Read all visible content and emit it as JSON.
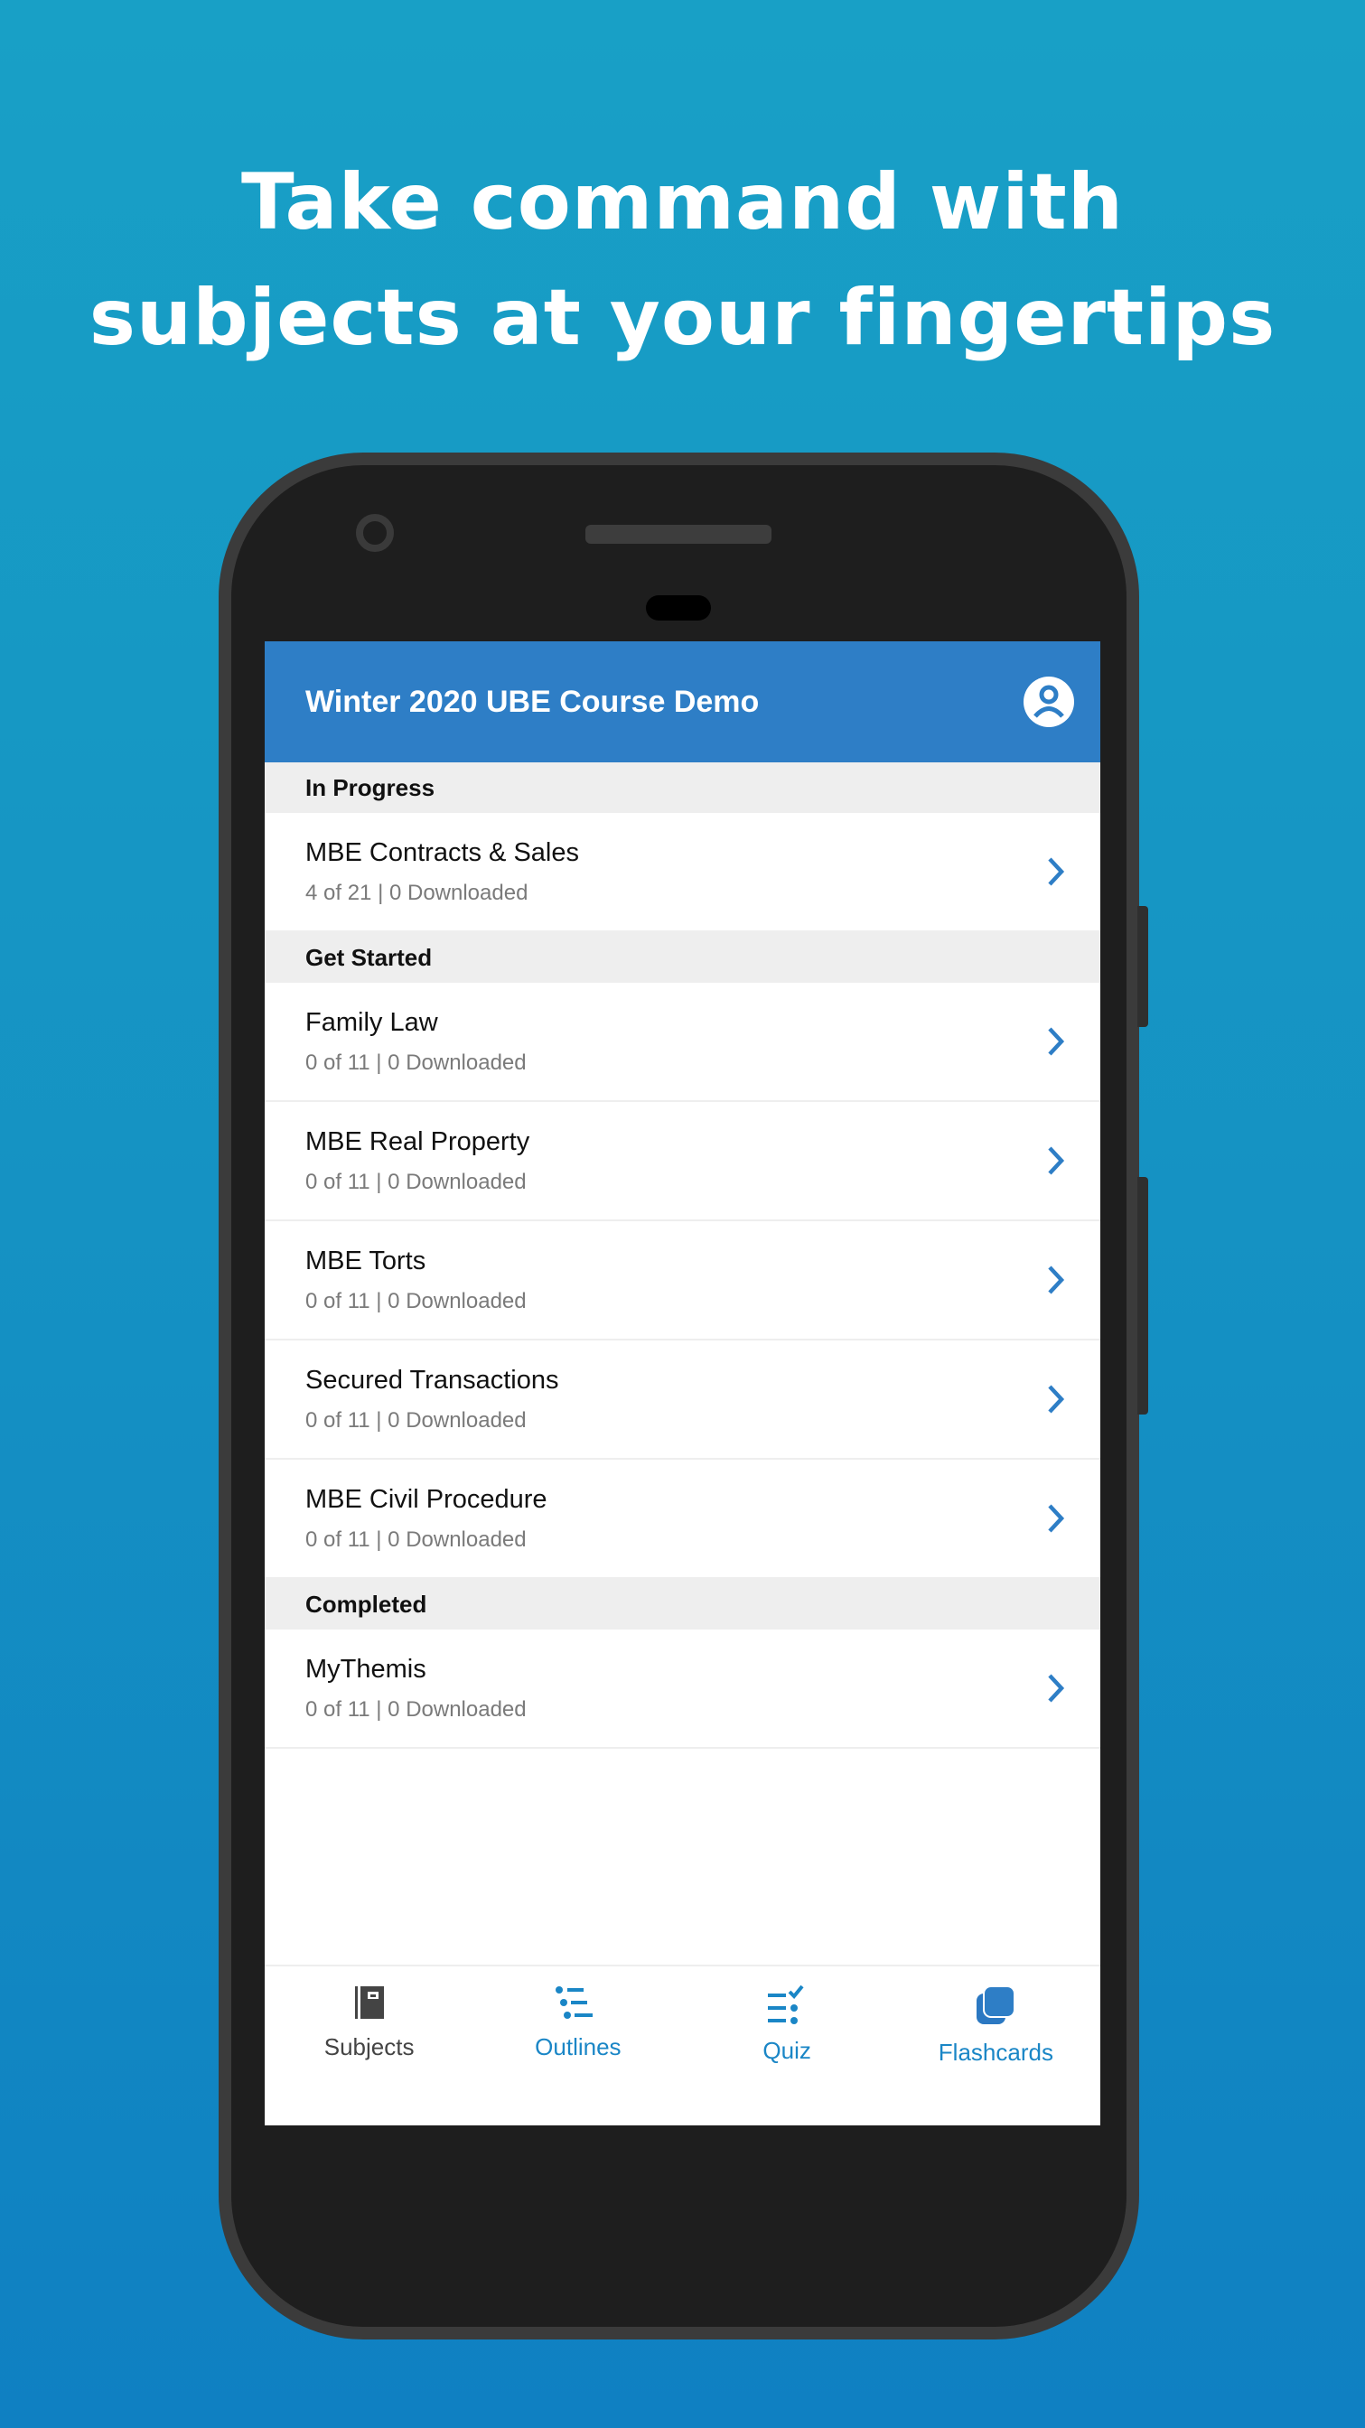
{
  "headline": {
    "line1": "Take command with",
    "line2": "subjects at your fingertips"
  },
  "app_bar": {
    "title": "Winter 2020 UBE Course Demo",
    "profile_icon": "account-circle-icon"
  },
  "sections": [
    {
      "label": "In Progress",
      "items": [
        {
          "title": "MBE Contracts & Sales",
          "subtitle": "4 of 21 | 0 Downloaded"
        }
      ]
    },
    {
      "label": "Get Started",
      "items": [
        {
          "title": "Family Law",
          "subtitle": "0 of 11 | 0 Downloaded"
        },
        {
          "title": "MBE Real Property",
          "subtitle": "0 of 11 | 0 Downloaded"
        },
        {
          "title": "MBE Torts",
          "subtitle": "0 of 11 | 0 Downloaded"
        },
        {
          "title": "Secured Transactions",
          "subtitle": "0 of 11 | 0 Downloaded"
        },
        {
          "title": "MBE Civil Procedure",
          "subtitle": "0 of 11 | 0 Downloaded"
        }
      ]
    },
    {
      "label": "Completed",
      "items": [
        {
          "title": "MyThemis",
          "subtitle": "0 of 11 | 0 Downloaded"
        }
      ]
    }
  ],
  "bottom_nav": [
    {
      "label": "Subjects",
      "icon": "notebook-icon",
      "active": true
    },
    {
      "label": "Outlines",
      "icon": "list-icon"
    },
    {
      "label": "Quiz",
      "icon": "checklist-icon"
    },
    {
      "label": "Flashcards",
      "icon": "cards-icon"
    }
  ],
  "colors": {
    "accent": "#2e7ec6",
    "nav_active": "#444444",
    "nav_inactive": "#1a86c6",
    "chevron": "#2e7ec6"
  }
}
